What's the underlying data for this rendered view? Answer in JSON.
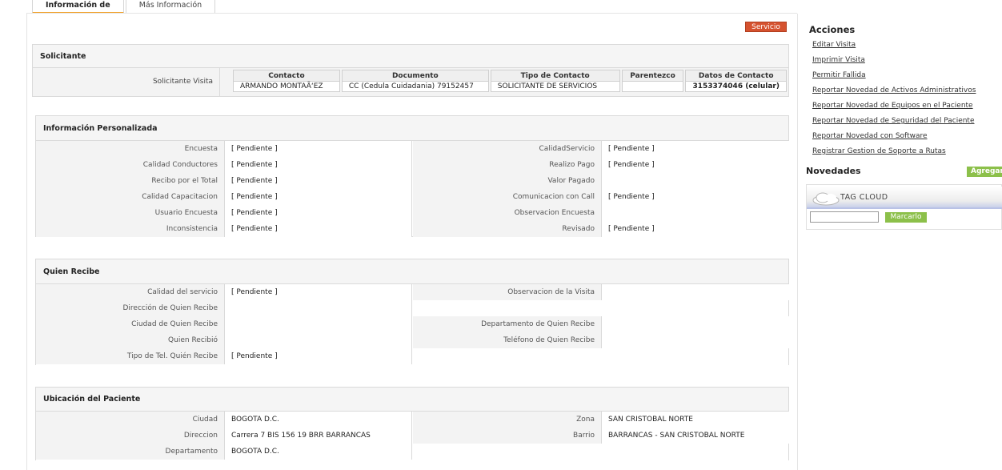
{
  "tabs": [
    {
      "label": "Información de"
    },
    {
      "label": "Más Información"
    }
  ],
  "servicio_button": "Servicio",
  "solicitante": {
    "title": "Solicitante",
    "row_label": "Solicitante Visita",
    "columns": [
      "Contacto",
      "Documento",
      "Tipo de Contacto",
      "Parentezco",
      "Datos de Contacto"
    ],
    "values": [
      "ARMANDO MONTAÃ‘EZ",
      "CC (Cedula Cuidadania) 79152457",
      "SOLICITANTE DE SERVICIOS",
      "",
      "3153374046 (celular)"
    ]
  },
  "info_personalizada": {
    "title": "Información Personalizada",
    "left": [
      {
        "label": "Encuesta",
        "value": "[ Pendiente ]"
      },
      {
        "label": "Calidad Conductores",
        "value": "[ Pendiente ]"
      },
      {
        "label": "Recibo por el Total",
        "value": "[ Pendiente ]"
      },
      {
        "label": "Calidad Capacitacion",
        "value": "[ Pendiente ]"
      },
      {
        "label": "Usuario Encuesta",
        "value": "[ Pendiente ]"
      },
      {
        "label": "Inconsistencia",
        "value": "[ Pendiente ]"
      }
    ],
    "right": [
      {
        "label": "CalidadServicio",
        "value": "[ Pendiente ]"
      },
      {
        "label": "Realizo Pago",
        "value": "[ Pendiente ]"
      },
      {
        "label": "Valor Pagado",
        "value": ""
      },
      {
        "label": "Comunicacion con Call",
        "value": "[ Pendiente ]"
      },
      {
        "label": "Observacion Encuesta",
        "value": ""
      },
      {
        "label": "Revisado",
        "value": "[ Pendiente ]"
      }
    ]
  },
  "quien_recibe": {
    "title": "Quien Recibe",
    "left": [
      {
        "label": "Calidad del servicio",
        "value": "[ Pendiente ]"
      },
      {
        "label": "Dirección de Quien Recibe",
        "value": ""
      },
      {
        "label": "Ciudad de Quien Recibe",
        "value": ""
      },
      {
        "label": "Quien Recibió",
        "value": ""
      },
      {
        "label": "Tipo de Tel. Quién Recibe",
        "value": "[ Pendiente ]"
      }
    ],
    "right": [
      {
        "label": "Observacion de la Visita",
        "value": ""
      },
      {
        "label": "Departamento de Quien Recibe",
        "value": ""
      },
      {
        "label": "Teléfono de Quien Recibe",
        "value": ""
      }
    ]
  },
  "ubicacion": {
    "title": "Ubicación del Paciente",
    "left": [
      {
        "label": "Ciudad",
        "value": "BOGOTA D.C."
      },
      {
        "label": "Direccion",
        "value": "Carrera 7 BIS 156 19 BRR BARRANCAS"
      },
      {
        "label": "Departamento",
        "value": "BOGOTA D.C."
      }
    ],
    "right": [
      {
        "label": "Zona",
        "value": "SAN CRISTOBAL NORTE"
      },
      {
        "label": "Barrio",
        "value": "BARRANCAS - SAN CRISTOBAL NORTE"
      }
    ]
  },
  "acciones": {
    "title": "Acciones",
    "links": [
      "Editar Visita",
      "Imprimir Visita",
      "Permitir Fallida",
      "Reportar Novedad de Activos Administrativos",
      "Reportar Novedad de Equipos en el Paciente",
      "Reportar Novedad de Seguridad del Paciente",
      "Reportar Novedad con Software",
      "Registrar Gestion de Soporte a Rutas"
    ]
  },
  "novedades": {
    "title": "Novedades",
    "agregar": "Agregar",
    "tag_cloud": "TAG CLOUD",
    "marcarlo": "Marcarlo",
    "input_value": ""
  }
}
